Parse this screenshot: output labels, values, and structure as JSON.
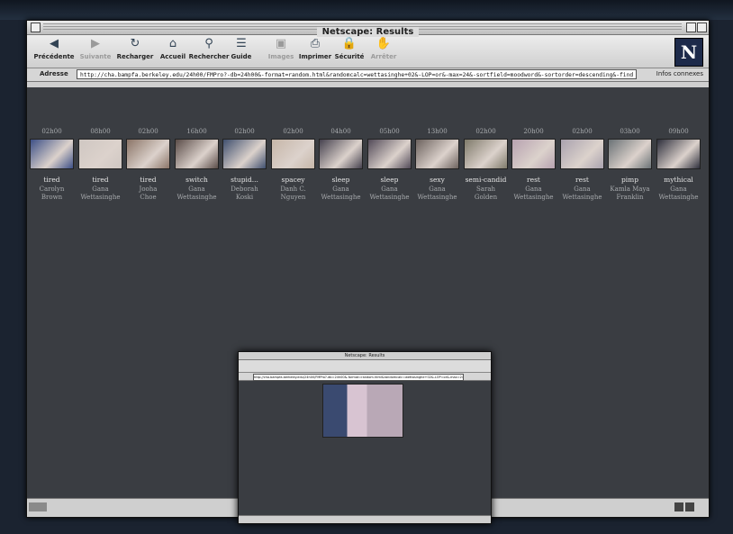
{
  "window": {
    "title": "Netscape: Results"
  },
  "toolbar": {
    "buttons": [
      {
        "label": "Précédente",
        "icon": "back-arrow-icon",
        "glyph": "◀",
        "enabled": true
      },
      {
        "label": "Suivante",
        "icon": "forward-arrow-icon",
        "glyph": "▶",
        "enabled": false
      },
      {
        "label": "Recharger",
        "icon": "reload-icon",
        "glyph": "↻",
        "enabled": true
      },
      {
        "label": "Accueil",
        "icon": "home-icon",
        "glyph": "⌂",
        "enabled": true
      },
      {
        "label": "Rechercher",
        "icon": "search-icon",
        "glyph": "⚲",
        "enabled": true
      },
      {
        "label": "Guide",
        "icon": "guide-icon",
        "glyph": "☰",
        "enabled": true
      },
      {
        "label": "Images",
        "icon": "images-icon",
        "glyph": "▣",
        "enabled": false
      },
      {
        "label": "Imprimer",
        "icon": "print-icon",
        "glyph": "⎙",
        "enabled": true
      },
      {
        "label": "Sécurité",
        "icon": "lock-icon",
        "glyph": "🔒",
        "enabled": true
      },
      {
        "label": "Arrêter",
        "icon": "stop-icon",
        "glyph": "✋",
        "enabled": false
      }
    ],
    "logo": "N"
  },
  "address": {
    "label": "Adresse",
    "url": "http://cha.bampfa.berkeley.edu/24h00/FMPro?-db=24h00&-format=random.html&randomcalc=wettasinghe+02&-LOP=or&-max=24&-sortfield=moodword&-sortorder=descending&-find",
    "related_label": "Infos connexes"
  },
  "results": [
    {
      "time": "02h00",
      "mood": "tired",
      "name": [
        "Carolyn",
        "Brown"
      ],
      "color": "#3c4f86"
    },
    {
      "time": "08h00",
      "mood": "tired",
      "name": [
        "Gana",
        "Wettasinghe"
      ],
      "color": "#cfc7c2"
    },
    {
      "time": "02h00",
      "mood": "tired",
      "name": [
        "Jooha",
        "Choe"
      ],
      "color": "#8b7467"
    },
    {
      "time": "16h00",
      "mood": "switch",
      "name": [
        "Gana",
        "Wettasinghe"
      ],
      "color": "#5a4c48"
    },
    {
      "time": "02h00",
      "mood": "stupid...",
      "name": [
        "Deborah",
        "Koski"
      ],
      "color": "#3f4f6e"
    },
    {
      "time": "02h00",
      "mood": "spacey",
      "name": [
        "Danh C.",
        "Nguyen"
      ],
      "color": "#c6b6a8"
    },
    {
      "time": "04h00",
      "mood": "sleep",
      "name": [
        "Gana",
        "Wettasinghe"
      ],
      "color": "#45414e"
    },
    {
      "time": "05h00",
      "mood": "sleep",
      "name": [
        "Gana",
        "Wettasinghe"
      ],
      "color": "#524a58"
    },
    {
      "time": "13h00",
      "mood": "sexy",
      "name": [
        "Gana",
        "Wettasinghe"
      ],
      "color": "#6c625e"
    },
    {
      "time": "02h00",
      "mood": "semi-candid",
      "name": [
        "Sarah",
        "Golden"
      ],
      "color": "#7e7a6a"
    },
    {
      "time": "20h00",
      "mood": "rest",
      "name": [
        "Gana",
        "Wettasinghe"
      ],
      "color": "#b7a2b0"
    },
    {
      "time": "02h00",
      "mood": "rest",
      "name": [
        "Gana",
        "Wettasinghe"
      ],
      "color": "#a9a2ae"
    },
    {
      "time": "03h00",
      "mood": "pimp",
      "name": [
        "Kamla Maya",
        "Franklin"
      ],
      "color": "#6a7276"
    },
    {
      "time": "09h00",
      "mood": "mythical",
      "name": [
        "Gana",
        "Wettasinghe"
      ],
      "color": "#2e2f3c"
    }
  ],
  "popup": {
    "title": "Netscape: Results"
  }
}
